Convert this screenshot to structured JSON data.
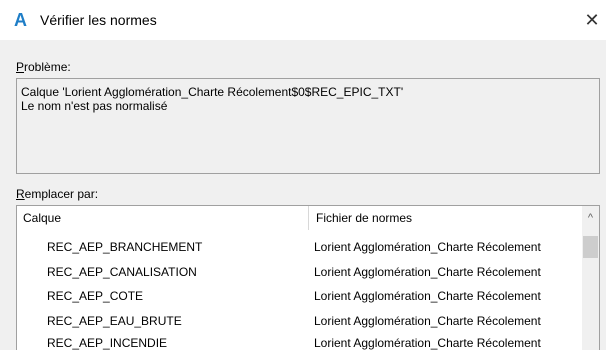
{
  "window": {
    "title": "Vérifier les normes",
    "icon": "autocad-a-icon",
    "close_glyph": "✕"
  },
  "problem": {
    "label_first": "P",
    "label_rest": "roblème:",
    "lines": [
      "Calque 'Lorient Agglomération_Charte Récolement$0$REC_EPIC_TXT'",
      "Le nom n'est pas normalisé"
    ]
  },
  "replace": {
    "label_first": "R",
    "label_rest": "emplacer par:",
    "columns": [
      "Calque",
      "Fichier de normes"
    ],
    "rows": [
      {
        "name": "REC_AEP_BRANCHEMENT",
        "file": "Lorient Agglomération_Charte Récolement"
      },
      {
        "name": "REC_AEP_CANALISATION",
        "file": "Lorient Agglomération_Charte Récolement"
      },
      {
        "name": "REC_AEP_COTE",
        "file": "Lorient Agglomération_Charte Récolement"
      },
      {
        "name": "REC_AEP_EAU_BRUTE",
        "file": "Lorient Agglomération_Charte Récolement"
      },
      {
        "name": "REC_AEP_INCENDIE",
        "file": "Lorient Agglomération_Charte Récolement"
      }
    ]
  },
  "scrollbar": {
    "up_glyph": "^"
  }
}
